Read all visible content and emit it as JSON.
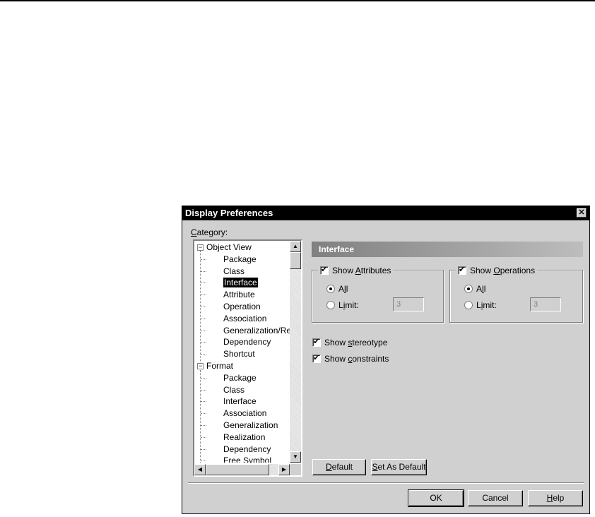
{
  "dialog": {
    "title": "Display Preferences",
    "close_glyph": "✕",
    "category_label": "Category:",
    "tree": [
      {
        "label": "Object View",
        "level": 0,
        "expander": "−"
      },
      {
        "label": "Package",
        "level": 1
      },
      {
        "label": "Class",
        "level": 1
      },
      {
        "label": "Interface",
        "level": 1,
        "selected": true
      },
      {
        "label": "Attribute",
        "level": 1
      },
      {
        "label": "Operation",
        "level": 1
      },
      {
        "label": "Association",
        "level": 1
      },
      {
        "label": "Generalization/Rea",
        "level": 1
      },
      {
        "label": "Dependency",
        "level": 1
      },
      {
        "label": "Shortcut",
        "level": 1
      },
      {
        "label": "Format",
        "level": 0,
        "expander": "−"
      },
      {
        "label": "Package",
        "level": 1
      },
      {
        "label": "Class",
        "level": 1
      },
      {
        "label": "Interface",
        "level": 1
      },
      {
        "label": "Association",
        "level": 1
      },
      {
        "label": "Generalization",
        "level": 1
      },
      {
        "label": "Realization",
        "level": 1
      },
      {
        "label": "Dependency",
        "level": 1
      },
      {
        "label": "Free Symbol",
        "level": 1
      }
    ],
    "section_title": "Interface",
    "attributes_group": {
      "show_label": "Show Attributes",
      "checked": true,
      "all_label": "All",
      "limit_label": "Limit:",
      "selected": "All",
      "limit_value": "3"
    },
    "operations_group": {
      "show_label": "Show Operations",
      "checked": true,
      "all_label": "All",
      "limit_label": "Limit:",
      "selected": "All",
      "limit_value": "3"
    },
    "show_stereotype": {
      "label": "Show stereotype",
      "checked": true
    },
    "show_constraints": {
      "label": "Show constraints",
      "checked": true
    },
    "buttons": {
      "default": "Default",
      "set_as_default": "Set As Default",
      "ok": "OK",
      "cancel": "Cancel",
      "help": "Help"
    },
    "scroll_glyphs": {
      "up": "▲",
      "down": "▼",
      "left": "◀",
      "right": "▶"
    }
  }
}
